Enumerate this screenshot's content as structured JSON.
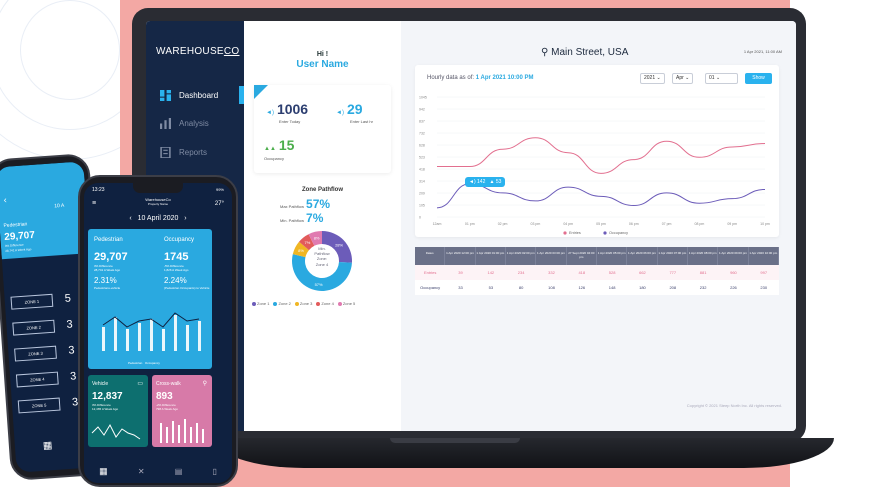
{
  "brand": {
    "prefix": "WAREHOUSE",
    "suffix": "CO"
  },
  "sidebar": {
    "items": [
      {
        "label": "Dashboard",
        "icon": "dashboard-icon",
        "active": true
      },
      {
        "label": "Analysis",
        "icon": "analysis-icon",
        "active": false
      },
      {
        "label": "Reports",
        "icon": "reports-icon",
        "active": false
      }
    ]
  },
  "greeting": {
    "line1": "Hi !",
    "line2": "User Name"
  },
  "stats": {
    "enter_today": {
      "value": "1006",
      "label": "Enter Today"
    },
    "enter_last_hr": {
      "value": "29",
      "label": "Enter Last hr"
    },
    "occupancy": {
      "value": "15",
      "label": "Occupancy"
    }
  },
  "pathflow": {
    "title": "Zone Pathflow",
    "max_label": "Max Pathflow",
    "max_value": "57%",
    "min_label": "Min. Pathflow",
    "min_value": "7%",
    "center_text": [
      "Min.",
      "Pathflow",
      "Zone:",
      "Zone 4"
    ],
    "slices": [
      {
        "zone": "Zone 1",
        "value": 28,
        "label": "28%",
        "color": "#6c5cb9"
      },
      {
        "zone": "Zone 2",
        "value": 57,
        "label": "57%",
        "color": "#2aa9e0"
      },
      {
        "zone": "Zone 3",
        "value": 8,
        "label": "8%",
        "color": "#f0b623"
      },
      {
        "zone": "Zone 4",
        "value": 7,
        "label": "7%",
        "color": "#e25b5b"
      },
      {
        "zone": "Zone 5",
        "value": 8,
        "label": "8%",
        "color": "#e07ab0"
      }
    ],
    "legend": [
      "Zone 1",
      "Zone 2",
      "Zone 3",
      "Zone 4",
      "Zone 5"
    ]
  },
  "header": {
    "location": "Main Street, USA",
    "datetime": "1 Apr 2021, 11:00 AM"
  },
  "chart": {
    "title_prefix": "Hourly data as of: ",
    "title_value": "1 Apr 2021 10:00 PM",
    "year": "2021",
    "month": "Apr",
    "day": "01",
    "show_label": "Show",
    "tooltip_entries": "142",
    "tooltip_occupancy": "53"
  },
  "chart_data": {
    "type": "line",
    "x": [
      "12am",
      "01 pm",
      "02 pm",
      "03 pm",
      "04 pm",
      "05 pm",
      "06 pm",
      "07 pm",
      "08 pm",
      "09 pm",
      "10 pm"
    ],
    "series": [
      {
        "name": "Entries",
        "color": "#e26f8f",
        "values": [
          440,
          440,
          590,
          690,
          560,
          380,
          500,
          660,
          520,
          610,
          640
        ]
      },
      {
        "name": "Occupancy",
        "color": "#6c5cb9",
        "values": [
          80,
          290,
          210,
          140,
          260,
          180,
          100,
          210,
          120,
          160,
          240
        ]
      }
    ],
    "yticks": [
      "1045",
      "942",
      "837",
      "732",
      "628",
      "523",
      "418",
      "314",
      "209",
      "105",
      "0"
    ],
    "ylim": [
      0,
      1045
    ],
    "legend": [
      "Entries",
      "Occupancy"
    ]
  },
  "table": {
    "headers": [
      "Dates",
      "1 Apr 2020 12:00 pm",
      "1 Apr 2020 01:00 pm",
      "1 Apr 2020 02:00 pm",
      "1 Apr 2020 03:00 pm",
      "27 Sept 2020 04:00 pm",
      "1 Apr 2020 05:00 pm",
      "1 Apr 2020 06:00 pm",
      "1 Apr 2020 07:00 pm",
      "1 Apr 2020 08:00 pm",
      "1 Apr 2020 09:00 pm",
      "1 Apr 2020 10:00 pm"
    ],
    "rows": [
      {
        "label": "Entries",
        "values": [
          "39",
          "142",
          "234",
          "332",
          "418",
          "528",
          "662",
          "777",
          "881",
          "960",
          "997"
        ]
      },
      {
        "label": "Occupancy",
        "values": [
          "33",
          "53",
          "80",
          "108",
          "126",
          "148",
          "180",
          "208",
          "232",
          "226",
          "230"
        ]
      }
    ]
  },
  "copyright": "Copyright © 2021 Steep North Inc. All rights reserved.",
  "phone_front": {
    "time": "13:23",
    "battery": "99%",
    "app_name": "WarehouseCo",
    "property": "Property Name",
    "temp": "27°",
    "date": "10 April 2020",
    "pedestrian": {
      "title": "Pedestrian",
      "value": "29,707",
      "diff": "3% Difference",
      "week": "28,741 A Week Ago",
      "pct": "2.31%",
      "pct_label": "Pedestrians-vehicle"
    },
    "occupancy": {
      "title": "Occupancy",
      "value": "1745",
      "diff": "-5% Difference",
      "week": "1,826 A Week Ago",
      "pct": "2.24%",
      "pct_label": "(Pedestrian Occupants) to Vehicle"
    },
    "chart_legend": [
      "Pedestrian",
      "Occupancy"
    ],
    "vehicle": {
      "title": "Vehicle",
      "value": "12,837",
      "diff": "3% Difference",
      "week": "12,465 A Week Ago"
    },
    "crosswalk": {
      "title": "Cross-walk",
      "value": "893",
      "diff": "-2% Difference",
      "week": "798 A Week Ago"
    }
  },
  "phone_back": {
    "date": "10 A",
    "title": "Pedestrian",
    "value": "29,707",
    "diff": "3% Difference",
    "week": "28,741 A Week Ago",
    "zones": [
      {
        "label": "ZONE 1",
        "value": "5"
      },
      {
        "label": "ZONE 2",
        "value": "3"
      },
      {
        "label": "ZONE 3",
        "value": "3"
      },
      {
        "label": "ZONE 4",
        "value": "3"
      },
      {
        "label": "ZONE 5",
        "value": "3"
      }
    ]
  }
}
